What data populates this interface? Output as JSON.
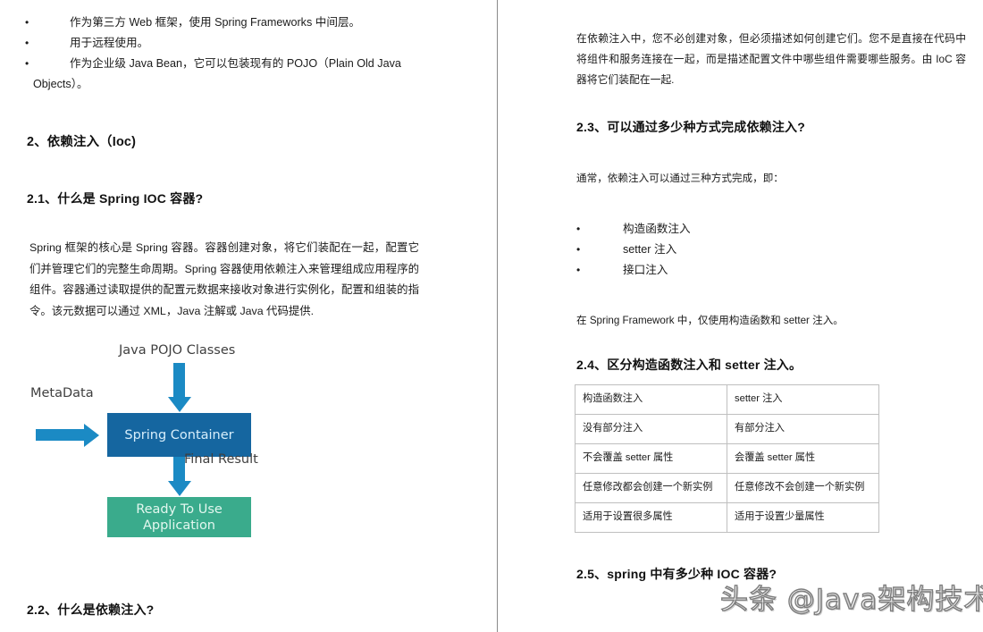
{
  "document": {
    "type": "two-column-scanned-page",
    "divider_color": "#8a8a8a"
  },
  "left_column": {
    "bullets": [
      {
        "text": "作为第三方 Web 框架，使用 Spring Frameworks 中间层。",
        "continuation": ""
      },
      {
        "text": "用于远程使用。",
        "continuation": ""
      },
      {
        "text": "作为企业级 Java Bean，它可以包装现有的 POJO（Plain Old Java",
        "continuation": "Objects）。"
      }
    ],
    "heading_2": "2、依赖注入（Ioc)",
    "heading_2_1": "2.1、什么是 Spring IOC 容器?",
    "paragraph": "Spring 框架的核心是 Spring 容器。容器创建对象，将它们装配在一起，配置它们并管理它们的完整生命周期。Spring 容器使用依赖注入来管理组成应用程序的组件。容器通过读取提供的配置元数据来接收对象进行实例化，配置和组装的指令。该元数据可以通过 XML，Java 注解或 Java 代码提供.",
    "figure": {
      "label_top": "Java POJO Classes",
      "label_left": "MetaData",
      "label_mid": "Final Result",
      "box_container": "Spring Container",
      "box_app_line1": "Ready To Use",
      "box_app_line2": "Application",
      "color_container": "#1566a0",
      "color_app": "#3aab8c",
      "color_arrow": "#1b8ac4"
    },
    "heading_2_2": "2.2、什么是依赖注入?"
  },
  "right_column": {
    "paragraph_1": "在依赖注入中，您不必创建对象，但必须描述如何创建它们。您不是直接在代码中将组件和服务连接在一起，而是描述配置文件中哪些组件需要哪些服务。由 IoC 容器将它们装配在一起.",
    "heading_2_3": "2.3、可以通过多少种方式完成依赖注入?",
    "note_1": "通常，依赖注入可以通过三种方式完成，即：",
    "bullets": [
      "构造函数注入",
      "setter 注入",
      "接口注入"
    ],
    "note_2": "在 Spring Framework 中，仅使用构造函数和 setter 注入。",
    "heading_2_4": "2.4、区分构造函数注入和 setter 注入。",
    "table": {
      "rows": [
        [
          "构造函数注入",
          "setter 注入"
        ],
        [
          "没有部分注入",
          "有部分注入"
        ],
        [
          "不会覆盖 setter 属性",
          "会覆盖 setter 属性"
        ],
        [
          "任意修改都会创建一个新实例",
          "任意修改不会创建一个新实例"
        ],
        [
          "适用于设置很多属性",
          "适用于设置少量属性"
        ]
      ]
    },
    "heading_2_5": "2.5、spring 中有多少种 IOC 容器?"
  },
  "watermark": {
    "text": "头条 @Java架构技术"
  }
}
